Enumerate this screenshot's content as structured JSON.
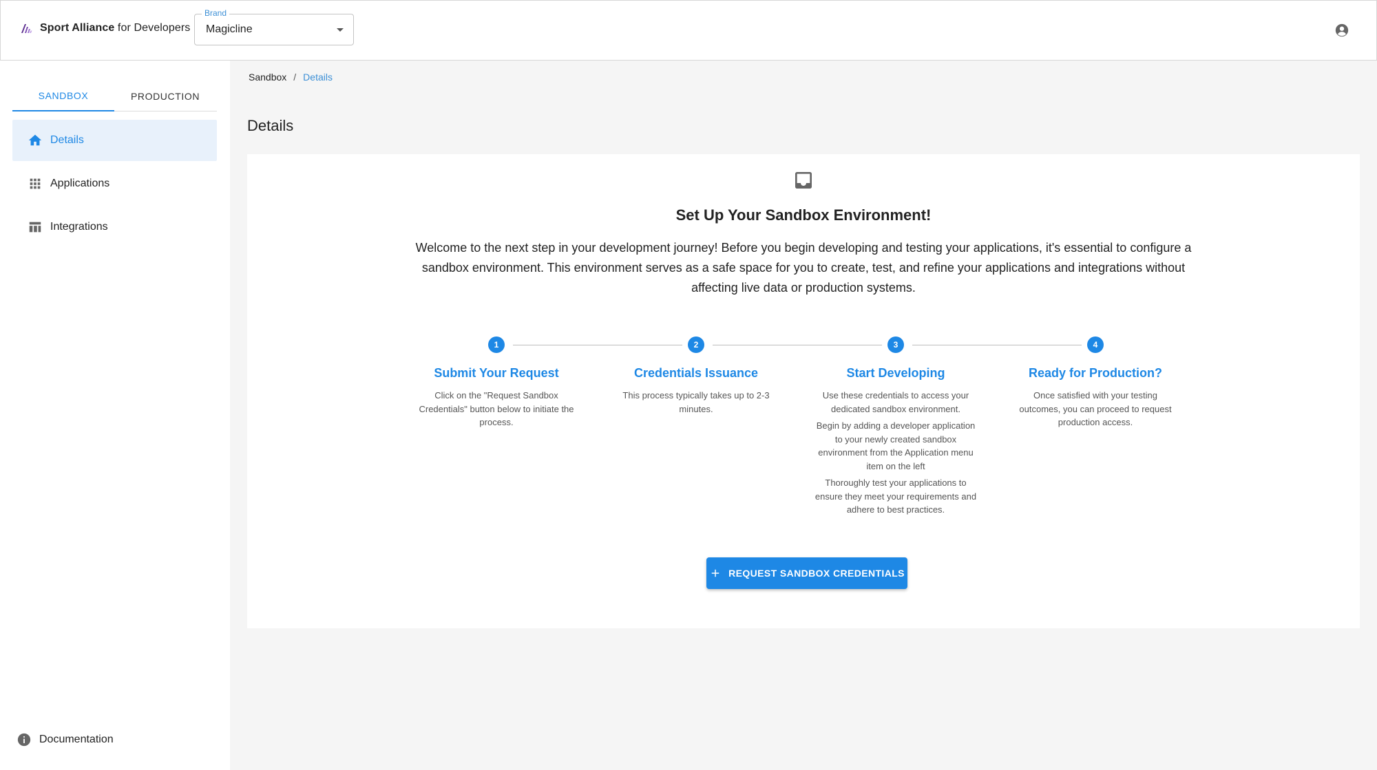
{
  "header": {
    "logo_bold": "Sport Alliance",
    "logo_rest": " for Developers",
    "brand_label": "Brand",
    "brand_value": "Magicline",
    "account_icon": "account-circle-icon"
  },
  "sidebar": {
    "tabs": [
      {
        "label": "SANDBOX",
        "active": true
      },
      {
        "label": "PRODUCTION",
        "active": false
      }
    ],
    "items": [
      {
        "label": "Details",
        "icon": "home-icon",
        "active": true
      },
      {
        "label": "Applications",
        "icon": "apps-grid-icon",
        "active": false
      },
      {
        "label": "Integrations",
        "icon": "table-icon",
        "active": false
      }
    ],
    "documentation": {
      "label": "Documentation",
      "icon": "info-icon"
    }
  },
  "breadcrumb": {
    "root": "Sandbox",
    "separator": "/",
    "current": "Details"
  },
  "page_title": "Details",
  "card": {
    "icon": "inbox-icon",
    "title": "Set Up Your Sandbox Environment!",
    "text": "Welcome to the next step in your development journey! Before you begin developing and testing your applications, it's essential to configure a sandbox environment. This environment serves as a safe space for you to create, test, and refine your applications and integrations without affecting live data or production systems.",
    "steps": [
      {
        "number": "1",
        "title": "Submit Your Request",
        "desc": [
          "Click on the \"Request Sandbox Credentials\" button below to initiate the process."
        ]
      },
      {
        "number": "2",
        "title": "Credentials Issuance",
        "desc": [
          "This process typically takes up to 2-3 minutes."
        ]
      },
      {
        "number": "3",
        "title": "Start Developing",
        "desc": [
          "Use these credentials to access your dedicated sandbox environment.",
          "Begin by adding a developer application to your newly created sandbox environment from the Application menu item on the left",
          "Thoroughly test your applications to ensure they meet your requirements and adhere to best practices."
        ]
      },
      {
        "number": "4",
        "title": "Ready for Production?",
        "desc": [
          "Once satisfied with your testing outcomes, you can proceed to request production access."
        ]
      }
    ],
    "button_label": "REQUEST SANDBOX CREDENTIALS"
  },
  "colors": {
    "accent": "#1e88e5",
    "active_bg": "#e8f1fb",
    "page_bg": "#f5f5f5"
  }
}
